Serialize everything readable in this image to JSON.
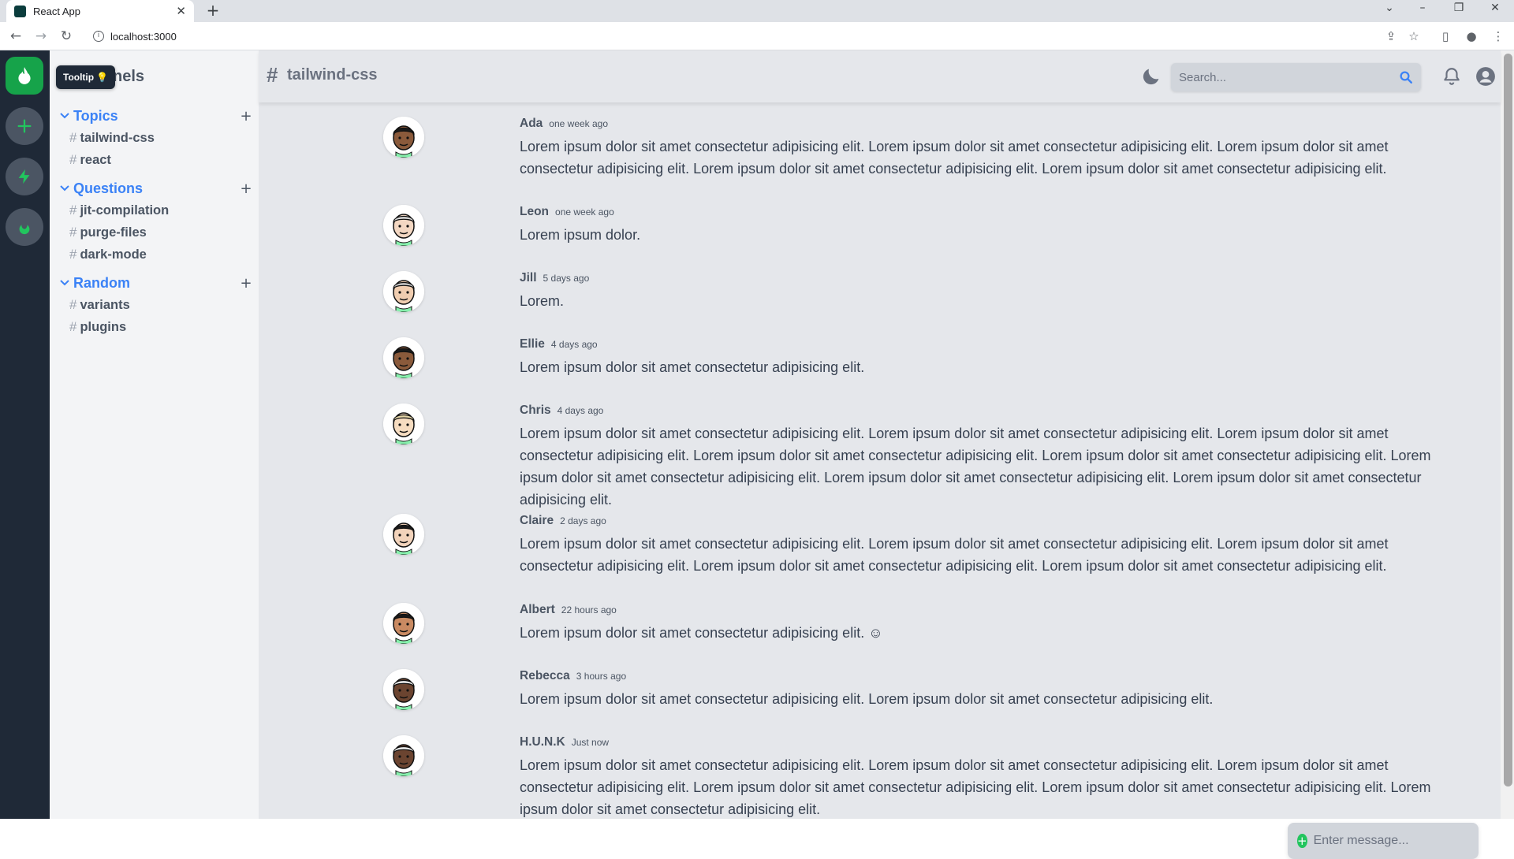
{
  "browser": {
    "tab_title": "React App",
    "tab_close": "✕",
    "new_tab": "+",
    "url": "localhost:3000",
    "controls": [
      "⌄",
      "–",
      "❐",
      "✕"
    ]
  },
  "servers": [
    {
      "icon": "fire-icon",
      "active": true
    },
    {
      "icon": "plus-icon",
      "active": false
    },
    {
      "icon": "bolt-icon",
      "active": false
    },
    {
      "icon": "fire-icon",
      "active": false
    }
  ],
  "tooltip": "Tooltip 💡",
  "channel_header": "Channels",
  "groups": [
    {
      "name": "Topics",
      "channels": [
        "tailwind-css",
        "react"
      ]
    },
    {
      "name": "Questions",
      "channels": [
        "jit-compilation",
        "purge-files",
        "dark-mode"
      ]
    },
    {
      "name": "Random",
      "channels": [
        "variants",
        "plugins"
      ]
    }
  ],
  "topnav": {
    "hash": "#",
    "title": "tailwind-css",
    "search_placeholder": "Search..."
  },
  "messages": [
    {
      "author": "Ada",
      "time": "one week ago",
      "text": "Lorem ipsum dolor sit amet consectetur adipisicing elit. Lorem ipsum dolor sit amet consectetur adipisicing elit. Lorem ipsum dolor sit amet consectetur adipisicing elit. Lorem ipsum dolor sit amet consectetur adipisicing elit. Lorem ipsum dolor sit amet consectetur adipisicing elit."
    },
    {
      "author": "Leon",
      "time": "one week ago",
      "text": "Lorem ipsum dolor."
    },
    {
      "author": "Jill",
      "time": "5 days ago",
      "text": "Lorem."
    },
    {
      "author": "Ellie",
      "time": "4 days ago",
      "text": "Lorem ipsum dolor sit amet consectetur adipisicing elit."
    },
    {
      "author": "Chris",
      "time": "4 days ago",
      "text": "Lorem ipsum dolor sit amet consectetur adipisicing elit. Lorem ipsum dolor sit amet consectetur adipisicing elit. Lorem ipsum dolor sit amet consectetur adipisicing elit. Lorem ipsum dolor sit amet consectetur adipisicing elit. Lorem ipsum dolor sit amet consectetur adipisicing elit. Lorem ipsum dolor sit amet consectetur adipisicing elit. Lorem ipsum dolor sit amet consectetur adipisicing elit. Lorem ipsum dolor sit amet consectetur adipisicing elit."
    },
    {
      "author": "Claire",
      "time": "2 days ago",
      "text": "Lorem ipsum dolor sit amet consectetur adipisicing elit. Lorem ipsum dolor sit amet consectetur adipisicing elit. Lorem ipsum dolor sit amet consectetur adipisicing elit. Lorem ipsum dolor sit amet consectetur adipisicing elit. Lorem ipsum dolor sit amet consectetur adipisicing elit."
    },
    {
      "author": "Albert",
      "time": "22 hours ago",
      "text": "Lorem ipsum dolor sit amet consectetur adipisicing elit. ☺"
    },
    {
      "author": "Rebecca",
      "time": "3 hours ago",
      "text": "Lorem ipsum dolor sit amet consectetur adipisicing elit. Lorem ipsum dolor sit amet consectetur adipisicing elit."
    },
    {
      "author": "H.U.N.K",
      "time": "Just now",
      "text": "Lorem ipsum dolor sit amet consectetur adipisicing elit. Lorem ipsum dolor sit amet consectetur adipisicing elit. Lorem ipsum dolor sit amet consectetur adipisicing elit. Lorem ipsum dolor sit amet consectetur adipisicing elit. Lorem ipsum dolor sit amet consectetur adipisicing elit. Lorem ipsum dolor sit amet consectetur adipisicing elit."
    }
  ],
  "composer": {
    "placeholder": "Enter message..."
  },
  "colors": {
    "accent_green": "#16a34a",
    "accent_blue": "#3b82f6",
    "sidebar_dark": "#1f2937"
  }
}
